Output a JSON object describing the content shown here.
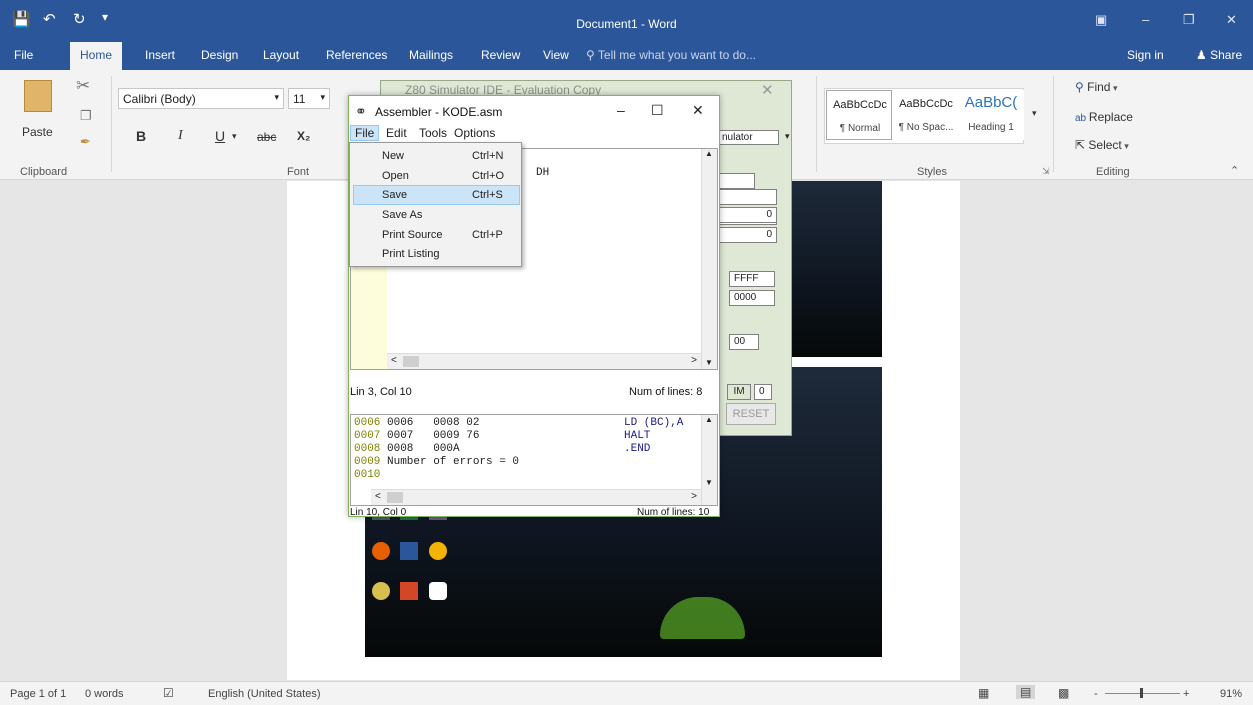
{
  "title_bar": {
    "document_title": "Document1 - Word",
    "save_icon": "floppy-disk-icon",
    "undo_icon": "undo-icon",
    "redo_icon": "redo-icon",
    "customize_icon": "customize-qat-icon"
  },
  "tabs": [
    "File",
    "Home",
    "Insert",
    "Design",
    "Layout",
    "References",
    "Mailings",
    "Review",
    "View"
  ],
  "active_tab": "Home",
  "tell_me": "Tell me what you want to do...",
  "sign_in": "Sign in",
  "share": "Share",
  "ribbon": {
    "clipboard": {
      "paste": "Paste",
      "label": "Clipboard"
    },
    "font": {
      "name": "Calibri (Body)",
      "size": "11",
      "label": "Font",
      "bold": "B",
      "italic": "I",
      "underline": "U",
      "strike": "abc",
      "subscript": "X₂"
    },
    "styles": {
      "label": "Styles",
      "items": [
        {
          "preview": "AaBbCcDc",
          "name": "¶ Normal"
        },
        {
          "preview": "AaBbCcDc",
          "name": "¶ No Spac..."
        },
        {
          "preview": "AaBbC(",
          "name": "Heading 1"
        }
      ]
    },
    "editing": {
      "label": "Editing",
      "find": "Find",
      "replace": "Replace",
      "select": "Select"
    }
  },
  "status_bar": {
    "page": "Page 1 of 1",
    "words": "0 words",
    "language": "English (United States)",
    "zoom": "91%",
    "zoom_minus": "-",
    "zoom_plus": "+"
  },
  "z80_window": {
    "title": "Z80 Simulator IDE - Evaluation Copy",
    "field_emulator": "nulator",
    "val0a": "0",
    "val0b": "0",
    "ffff": "FFFF",
    "zero4": "0000",
    "zero2": "00",
    "im": "IM",
    "im_val": "0",
    "reset": "RESET"
  },
  "assembler": {
    "title": "Assembler - KODE.asm",
    "menu": [
      "File",
      "Edit",
      "Tools",
      "Options"
    ],
    "top_code_fragment": "DH",
    "top_status_left": "Lin 3, Col 10",
    "top_status_right": "Num of lines: 8",
    "listing": [
      {
        "ln": "0006",
        "text": "0006   0008 02",
        "op": "LD (BC),A"
      },
      {
        "ln": "0007",
        "text": "0007   0009 76",
        "op": "HALT"
      },
      {
        "ln": "0008",
        "text": "0008   000A",
        "op": ".END"
      },
      {
        "ln": "0009",
        "text": "Number of errors = 0",
        "op": ""
      },
      {
        "ln": "0010",
        "text": "",
        "op": ""
      }
    ],
    "bottom_status_left": "Lin 10, Col 0",
    "bottom_status_right": "Num of lines: 10"
  },
  "file_menu": [
    {
      "label": "New",
      "shortcut": "Ctrl+N"
    },
    {
      "label": "Open",
      "shortcut": "Ctrl+O"
    },
    {
      "label": "Save",
      "shortcut": "Ctrl+S"
    },
    {
      "label": "Save As",
      "shortcut": ""
    },
    {
      "label": "Print Source",
      "shortcut": "Ctrl+P"
    },
    {
      "label": "Print Listing",
      "shortcut": ""
    }
  ],
  "file_menu_selected": "Save"
}
